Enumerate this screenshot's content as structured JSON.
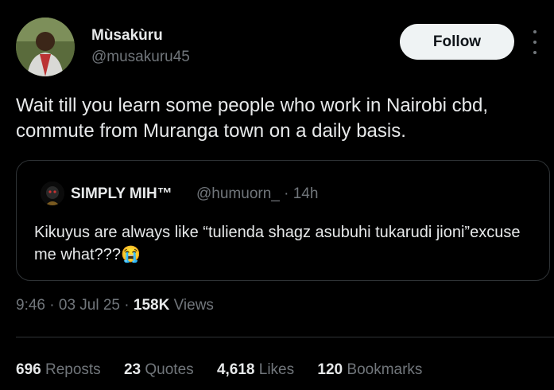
{
  "author": {
    "display_name": "Mùsakùru",
    "handle": "@musakuru45"
  },
  "follow_label": "Follow",
  "tweet_text": "Wait till you learn some people who work in Nairobi cbd, commute from Muranga town on a daily basis.",
  "quoted": {
    "display_name": "SIMPLY MIH™",
    "handle_time": "@humuorn_ · 14h",
    "text": "Kikuyus are always like “tulienda shagz asubuhi tukarudi jioni”excuse me what???😭"
  },
  "meta": {
    "time": "9:46",
    "date": "03 Jul 25",
    "views_count": "158K",
    "views_label": "Views"
  },
  "stats": {
    "reposts_count": "696",
    "reposts_label": "Reposts",
    "quotes_count": "23",
    "quotes_label": "Quotes",
    "likes_count": "4,618",
    "likes_label": "Likes",
    "bookmarks_count": "120",
    "bookmarks_label": "Bookmarks"
  },
  "icons": {
    "more": "more-vertical-icon"
  }
}
